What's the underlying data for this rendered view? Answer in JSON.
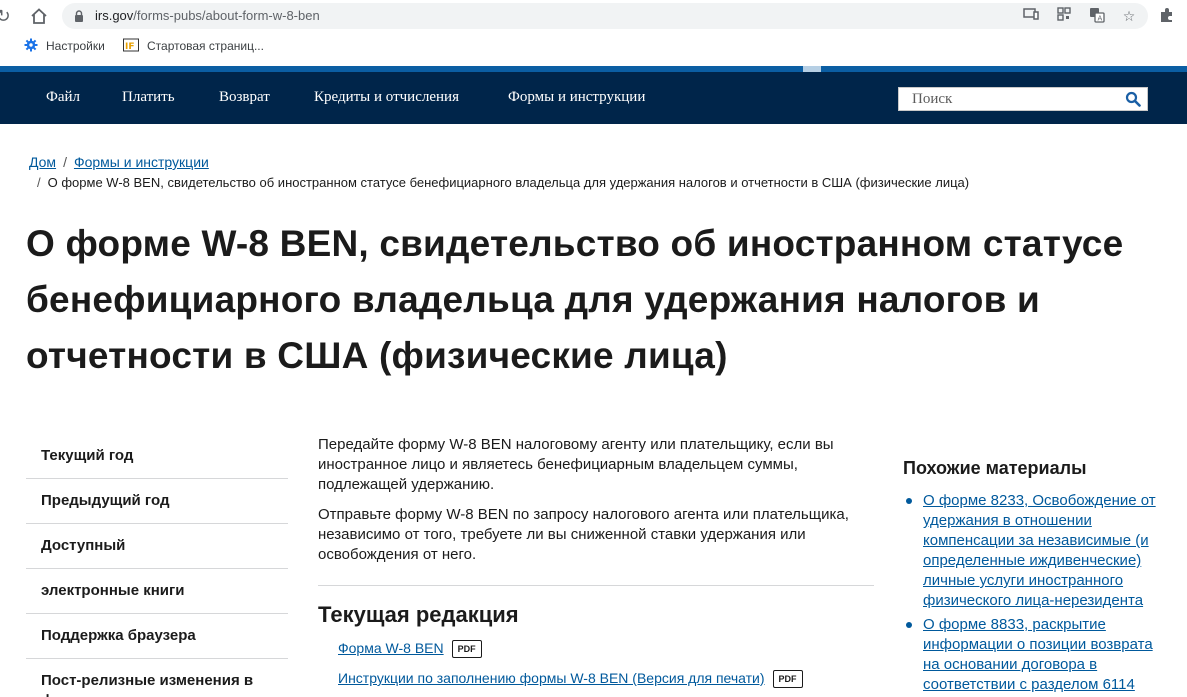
{
  "browser": {
    "url_host": "irs.gov",
    "url_path": "/forms-pubs/about-form-w-8-ben",
    "bookmarks": [
      {
        "label": "Настройки",
        "icon": "gear-icon"
      },
      {
        "label": "Стартовая страниц...",
        "icon": "iframe-icon"
      }
    ]
  },
  "site_nav": {
    "items": [
      "Файл",
      "Платить",
      "Возврат",
      "Кредиты и отчисления",
      "Формы и инструкции"
    ],
    "search_placeholder": "Поиск"
  },
  "breadcrumb": {
    "items": [
      "Дом",
      "Формы и инструкции"
    ],
    "current": "О форме W-8 BEN, свидетельство об иностранном статусе бенефициарного владельца для удержания налогов и отчетности в США (физические лица)"
  },
  "page_title": "О форме W-8 BEN, свидетельство об иностранном статусе бенефициарного владельца для удержания налогов и отчетности в США (физические лица)",
  "sidebar": {
    "items": [
      "Текущий год",
      "Предыдущий год",
      "Доступный",
      "электронные книги",
      "Поддержка браузера",
      "Пост-релизные изменения в формах"
    ]
  },
  "main": {
    "paragraphs": [
      "Передайте форму W-8 BEN налоговому агенту или плательщику, если вы иностранное лицо и являетесь бенефициарным владельцем суммы, подлежащей удержанию.",
      "Отправьте форму W-8 BEN по запросу налогового агента или плательщика, независимо от того, требуете ли вы сниженной ставки удержания или освобождения от него."
    ],
    "current_heading": "Текущая редакция",
    "files": [
      {
        "label": "Форма W-8 BEN",
        "badge": "PDF"
      },
      {
        "label": "Инструкции по заполнению формы W-8 BEN  (Версия для печати)",
        "badge": "PDF"
      }
    ]
  },
  "related": {
    "heading": "Похожие материалы",
    "links": [
      "О форме 8233, Освобождение от удержания в отношении компенсации за независимые (и определенные иждивенческие) личные услуги иностранного физического лица-нерезидента",
      "О форме 8833, раскрытие информации о позиции возврата на основании договора в соответствии с разделом 6114"
    ]
  },
  "colors": {
    "nav_bg": "#00254a",
    "stripe": "#0b5ea3",
    "link": "#00599c"
  }
}
